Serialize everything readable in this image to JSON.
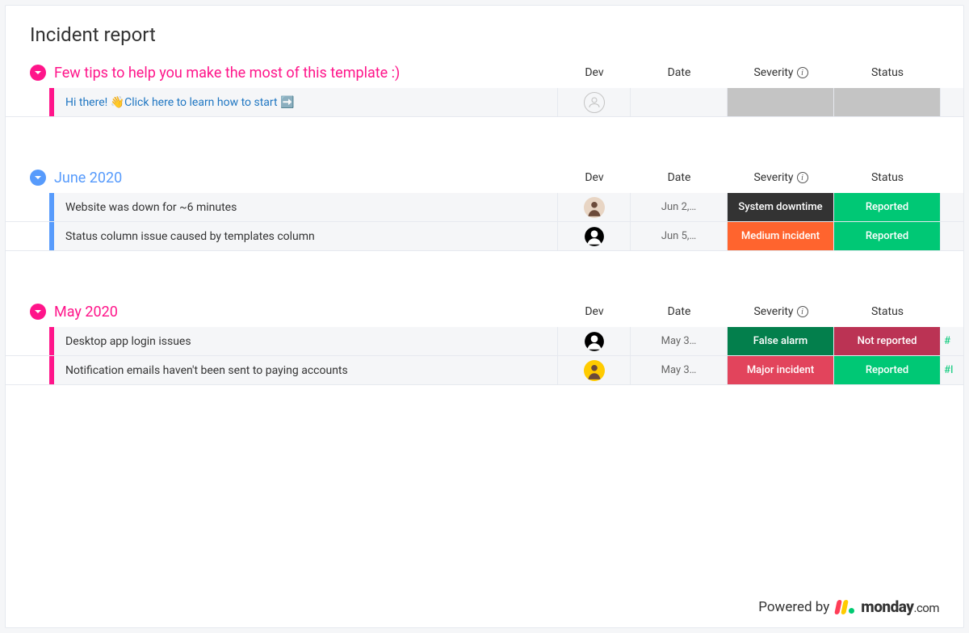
{
  "board_title": "Incident report",
  "columns": {
    "dev": "Dev",
    "date": "Date",
    "severity": "Severity",
    "status": "Status"
  },
  "colors": {
    "pink": "#ff158a",
    "blue": "#579bfc",
    "system_downtime": "#333333",
    "medium_incident": "#ff642e",
    "major_incident": "#e2445c",
    "false_alarm": "#037f4c",
    "reported": "#00c875",
    "not_reported": "#bb3354",
    "grey_cell": "#c4c4c4"
  },
  "groups": [
    {
      "id": "tips",
      "title": "Few tips to help you make the most of this template :)",
      "color": "#ff158a",
      "rows": [
        {
          "name": "Hi there! 👋Click here to learn how to start ➡️",
          "name_style": "link",
          "dev": {
            "type": "placeholder"
          },
          "date": "",
          "severity": {
            "label": "",
            "bg": "#c4c4c4"
          },
          "status": {
            "label": "",
            "bg": "#c4c4c4"
          },
          "extra": ""
        }
      ]
    },
    {
      "id": "june",
      "title": "June 2020",
      "color": "#579bfc",
      "rows": [
        {
          "name": "Website was down for ~6 minutes",
          "dev": {
            "type": "photo",
            "bg": "#e8d5c4"
          },
          "date": "Jun 2,…",
          "severity": {
            "label": "System downtime",
            "bg": "#333333"
          },
          "status": {
            "label": "Reported",
            "bg": "#00c875"
          },
          "extra": ""
        },
        {
          "name": "Status column issue caused by templates column",
          "dev": {
            "type": "icon"
          },
          "date": "Jun 5,…",
          "severity": {
            "label": "Medium incident",
            "bg": "#ff642e"
          },
          "status": {
            "label": "Reported",
            "bg": "#00c875"
          },
          "extra": ""
        }
      ]
    },
    {
      "id": "may",
      "title": "May 2020",
      "color": "#ff158a",
      "rows": [
        {
          "name": "Desktop app login issues",
          "dev": {
            "type": "icon"
          },
          "date": "May 3…",
          "severity": {
            "label": "False alarm",
            "bg": "#037f4c"
          },
          "status": {
            "label": "Not reported",
            "bg": "#bb3354"
          },
          "extra": "#"
        },
        {
          "name": "Notification emails haven't been sent to paying accounts",
          "dev": {
            "type": "photo",
            "bg": "#ffcb00"
          },
          "date": "May 3…",
          "severity": {
            "label": "Major incident",
            "bg": "#e2445c"
          },
          "status": {
            "label": "Reported",
            "bg": "#00c875"
          },
          "extra": "#I"
        }
      ]
    }
  ],
  "footer": {
    "powered_by": "Powered by",
    "brand": "monday",
    "suffix": ".com"
  }
}
